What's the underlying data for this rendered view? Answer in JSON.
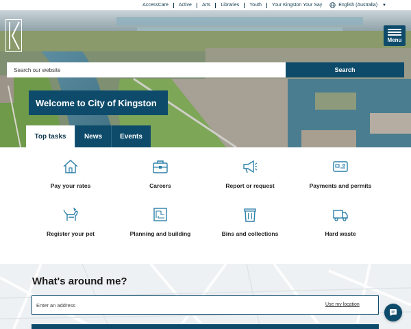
{
  "utility_nav": {
    "links": [
      "AccessCare",
      "Active",
      "Arts",
      "Libraries",
      "Youth",
      "Your Kingston Your Say"
    ],
    "language": "English (Australia)"
  },
  "header": {
    "menu_label": "Menu"
  },
  "search": {
    "placeholder": "Search our website",
    "button_label": "Search"
  },
  "hero": {
    "welcome": "Welcome to City of Kingston"
  },
  "tabs": [
    {
      "label": "Top tasks",
      "active": true
    },
    {
      "label": "News",
      "active": false
    },
    {
      "label": "Events",
      "active": false
    }
  ],
  "tasks": [
    {
      "label": "Pay your rates",
      "icon": "house-icon"
    },
    {
      "label": "Careers",
      "icon": "briefcase-icon"
    },
    {
      "label": "Report or request",
      "icon": "megaphone-icon"
    },
    {
      "label": "Payments and permits",
      "icon": "card-icon"
    },
    {
      "label": "Register your pet",
      "icon": "dog-icon"
    },
    {
      "label": "Planning and building",
      "icon": "blueprint-icon"
    },
    {
      "label": "Bins and collections",
      "icon": "bin-icon"
    },
    {
      "label": "Hard waste",
      "icon": "truck-icon"
    }
  ],
  "around_me": {
    "title": "What's around me?",
    "placeholder": "Enter an address",
    "use_location": "Use my location"
  },
  "colors": {
    "brand_navy": "#0e4b6b",
    "icon_blue": "#2c7fa8",
    "hero_green": "#6e9a4a",
    "water": "#4f7f93"
  }
}
